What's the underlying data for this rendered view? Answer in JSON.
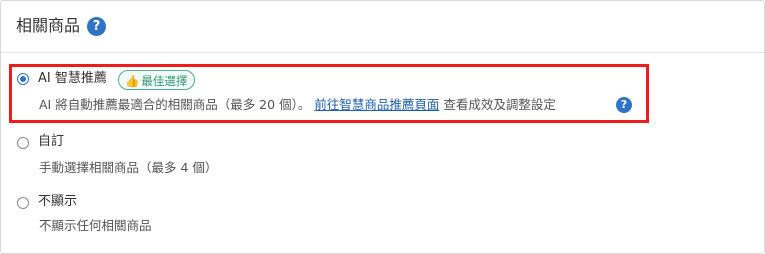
{
  "section": {
    "title": "相關商品",
    "help_icon": "question-circle-icon"
  },
  "options": [
    {
      "label": "AI 智慧推薦",
      "selected": true,
      "badge": "最佳選擇",
      "badge_icon": "thumbs-up-icon",
      "desc_before": "AI 將自動推薦最適合的相關商品（最多 20 個）。",
      "link": "前往智慧商品推薦頁面",
      "desc_after": "查看成效及調整設定"
    },
    {
      "label": "自訂",
      "selected": false,
      "desc": "手動選擇相關商品（最多 4 個）"
    },
    {
      "label": "不顯示",
      "selected": false,
      "desc": "不顯示任何相關商品"
    }
  ],
  "colors": {
    "accent": "#2f73c8",
    "highlight_border": "#ee1c1c",
    "badge_green": "#2f9a72"
  }
}
